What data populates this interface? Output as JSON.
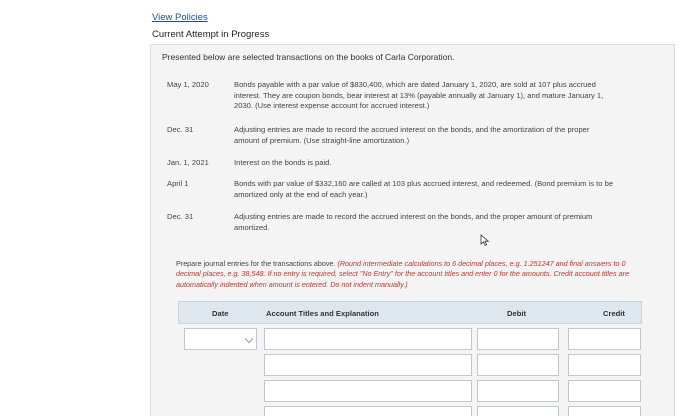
{
  "header": {
    "view_policies": "View Policies",
    "attempt_status": "Current Attempt in Progress"
  },
  "problem": {
    "intro": "Presented below are selected transactions on the books of Carla Corporation.",
    "transactions": [
      {
        "date": "May 1, 2020",
        "lines": [
          "Bonds payable with a par value of $830,400, which are dated January 1, 2020, are sold at 107 plus accrued",
          "interest. They are coupon bonds, bear interest at 13% (payable annually at January 1), and mature January 1,",
          "2030. (Use interest expense account for accrued interest.)"
        ]
      },
      {
        "date": "Dec. 31",
        "lines": [
          "Adjusting entries are made to record the accrued interest on the bonds, and the amortization of the proper",
          "amount of premium. (Use straight-line amortization.)"
        ]
      },
      {
        "date": "Jan. 1, 2021",
        "lines": [
          "Interest on the bonds is paid."
        ]
      },
      {
        "date": "April 1",
        "lines": [
          "Bonds with par value of $332,160 are called at 103 plus accrued interest, and redeemed. (Bond premium is to be",
          "amortized only at the end of each year.)"
        ]
      },
      {
        "date": "Dec. 31",
        "lines": [
          "Adjusting entries are made to record the accrued interest on the bonds, and the proper amount of premium",
          "amortized."
        ]
      }
    ],
    "instructions_plain": "Prepare journal entries for the transactions above.",
    "instructions_italic_1": "(Round intermediate calculations to 6 decimal places, e.g. 1.251247 and final answers",
    "instructions_italic_2": "to 0 decimal places, e.g. 38,548. If no entry is required, select \"No Entry\" for the account titles and enter 0 for the amounts. Credit account",
    "instructions_italic_3": "titles are automatically indented when amount is entered. Do not indent manually.)"
  },
  "journal": {
    "headers": {
      "date": "Date",
      "account": "Account Titles and Explanation",
      "debit": "Debit",
      "credit": "Credit"
    },
    "rows": [
      {
        "date": "",
        "account": "",
        "debit": "",
        "credit": ""
      },
      {
        "date": "",
        "account": "",
        "debit": "",
        "credit": ""
      },
      {
        "date": "",
        "account": "",
        "debit": "",
        "credit": ""
      },
      {
        "date": "",
        "account": "",
        "debit": "",
        "credit": ""
      }
    ]
  },
  "colors": {
    "link": "#1f4f8f",
    "panel_bg": "#f4f4f4",
    "table_header_bg": "#dfe7ee",
    "instruction_red": "#c0392b"
  },
  "icons": [
    "cursor-arrow-icon",
    "dropdown-chevron-icon"
  ]
}
